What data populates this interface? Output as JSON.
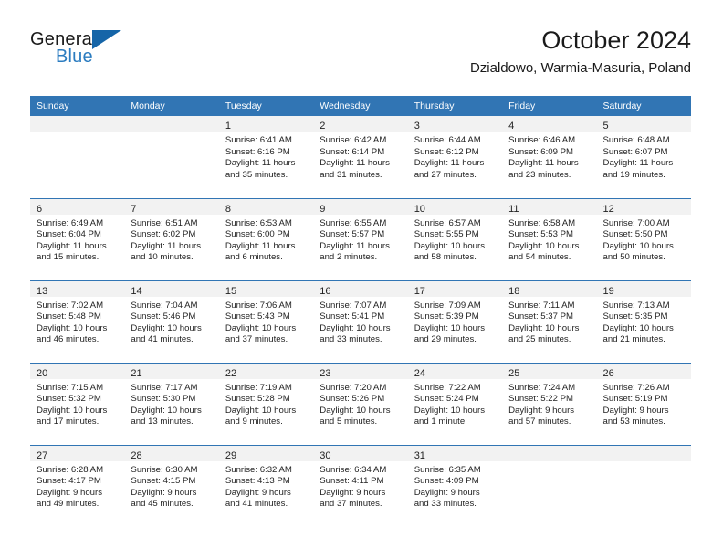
{
  "brand": {
    "line1": "General",
    "line2": "Blue",
    "triangle_icon": "triangle-icon",
    "accent_color": "#2b7cc0"
  },
  "header": {
    "title": "October 2024",
    "subtitle": "Dzialdowo, Warmia-Masuria, Poland"
  },
  "colors": {
    "header_blue": "#3175b4",
    "band_gray": "#f2f2f2",
    "text": "#222222"
  },
  "weekdays": [
    "Sunday",
    "Monday",
    "Tuesday",
    "Wednesday",
    "Thursday",
    "Friday",
    "Saturday"
  ],
  "weeks": [
    [
      {
        "day": "",
        "lines": []
      },
      {
        "day": "",
        "lines": []
      },
      {
        "day": "1",
        "lines": [
          "Sunrise: 6:41 AM",
          "Sunset: 6:16 PM",
          "Daylight: 11 hours",
          "and 35 minutes."
        ]
      },
      {
        "day": "2",
        "lines": [
          "Sunrise: 6:42 AM",
          "Sunset: 6:14 PM",
          "Daylight: 11 hours",
          "and 31 minutes."
        ]
      },
      {
        "day": "3",
        "lines": [
          "Sunrise: 6:44 AM",
          "Sunset: 6:12 PM",
          "Daylight: 11 hours",
          "and 27 minutes."
        ]
      },
      {
        "day": "4",
        "lines": [
          "Sunrise: 6:46 AM",
          "Sunset: 6:09 PM",
          "Daylight: 11 hours",
          "and 23 minutes."
        ]
      },
      {
        "day": "5",
        "lines": [
          "Sunrise: 6:48 AM",
          "Sunset: 6:07 PM",
          "Daylight: 11 hours",
          "and 19 minutes."
        ]
      }
    ],
    [
      {
        "day": "6",
        "lines": [
          "Sunrise: 6:49 AM",
          "Sunset: 6:04 PM",
          "Daylight: 11 hours",
          "and 15 minutes."
        ]
      },
      {
        "day": "7",
        "lines": [
          "Sunrise: 6:51 AM",
          "Sunset: 6:02 PM",
          "Daylight: 11 hours",
          "and 10 minutes."
        ]
      },
      {
        "day": "8",
        "lines": [
          "Sunrise: 6:53 AM",
          "Sunset: 6:00 PM",
          "Daylight: 11 hours",
          "and 6 minutes."
        ]
      },
      {
        "day": "9",
        "lines": [
          "Sunrise: 6:55 AM",
          "Sunset: 5:57 PM",
          "Daylight: 11 hours",
          "and 2 minutes."
        ]
      },
      {
        "day": "10",
        "lines": [
          "Sunrise: 6:57 AM",
          "Sunset: 5:55 PM",
          "Daylight: 10 hours",
          "and 58 minutes."
        ]
      },
      {
        "day": "11",
        "lines": [
          "Sunrise: 6:58 AM",
          "Sunset: 5:53 PM",
          "Daylight: 10 hours",
          "and 54 minutes."
        ]
      },
      {
        "day": "12",
        "lines": [
          "Sunrise: 7:00 AM",
          "Sunset: 5:50 PM",
          "Daylight: 10 hours",
          "and 50 minutes."
        ]
      }
    ],
    [
      {
        "day": "13",
        "lines": [
          "Sunrise: 7:02 AM",
          "Sunset: 5:48 PM",
          "Daylight: 10 hours",
          "and 46 minutes."
        ]
      },
      {
        "day": "14",
        "lines": [
          "Sunrise: 7:04 AM",
          "Sunset: 5:46 PM",
          "Daylight: 10 hours",
          "and 41 minutes."
        ]
      },
      {
        "day": "15",
        "lines": [
          "Sunrise: 7:06 AM",
          "Sunset: 5:43 PM",
          "Daylight: 10 hours",
          "and 37 minutes."
        ]
      },
      {
        "day": "16",
        "lines": [
          "Sunrise: 7:07 AM",
          "Sunset: 5:41 PM",
          "Daylight: 10 hours",
          "and 33 minutes."
        ]
      },
      {
        "day": "17",
        "lines": [
          "Sunrise: 7:09 AM",
          "Sunset: 5:39 PM",
          "Daylight: 10 hours",
          "and 29 minutes."
        ]
      },
      {
        "day": "18",
        "lines": [
          "Sunrise: 7:11 AM",
          "Sunset: 5:37 PM",
          "Daylight: 10 hours",
          "and 25 minutes."
        ]
      },
      {
        "day": "19",
        "lines": [
          "Sunrise: 7:13 AM",
          "Sunset: 5:35 PM",
          "Daylight: 10 hours",
          "and 21 minutes."
        ]
      }
    ],
    [
      {
        "day": "20",
        "lines": [
          "Sunrise: 7:15 AM",
          "Sunset: 5:32 PM",
          "Daylight: 10 hours",
          "and 17 minutes."
        ]
      },
      {
        "day": "21",
        "lines": [
          "Sunrise: 7:17 AM",
          "Sunset: 5:30 PM",
          "Daylight: 10 hours",
          "and 13 minutes."
        ]
      },
      {
        "day": "22",
        "lines": [
          "Sunrise: 7:19 AM",
          "Sunset: 5:28 PM",
          "Daylight: 10 hours",
          "and 9 minutes."
        ]
      },
      {
        "day": "23",
        "lines": [
          "Sunrise: 7:20 AM",
          "Sunset: 5:26 PM",
          "Daylight: 10 hours",
          "and 5 minutes."
        ]
      },
      {
        "day": "24",
        "lines": [
          "Sunrise: 7:22 AM",
          "Sunset: 5:24 PM",
          "Daylight: 10 hours",
          "and 1 minute."
        ]
      },
      {
        "day": "25",
        "lines": [
          "Sunrise: 7:24 AM",
          "Sunset: 5:22 PM",
          "Daylight: 9 hours",
          "and 57 minutes."
        ]
      },
      {
        "day": "26",
        "lines": [
          "Sunrise: 7:26 AM",
          "Sunset: 5:19 PM",
          "Daylight: 9 hours",
          "and 53 minutes."
        ]
      }
    ],
    [
      {
        "day": "27",
        "lines": [
          "Sunrise: 6:28 AM",
          "Sunset: 4:17 PM",
          "Daylight: 9 hours",
          "and 49 minutes."
        ]
      },
      {
        "day": "28",
        "lines": [
          "Sunrise: 6:30 AM",
          "Sunset: 4:15 PM",
          "Daylight: 9 hours",
          "and 45 minutes."
        ]
      },
      {
        "day": "29",
        "lines": [
          "Sunrise: 6:32 AM",
          "Sunset: 4:13 PM",
          "Daylight: 9 hours",
          "and 41 minutes."
        ]
      },
      {
        "day": "30",
        "lines": [
          "Sunrise: 6:34 AM",
          "Sunset: 4:11 PM",
          "Daylight: 9 hours",
          "and 37 minutes."
        ]
      },
      {
        "day": "31",
        "lines": [
          "Sunrise: 6:35 AM",
          "Sunset: 4:09 PM",
          "Daylight: 9 hours",
          "and 33 minutes."
        ]
      },
      {
        "day": "",
        "lines": []
      },
      {
        "day": "",
        "lines": []
      }
    ]
  ]
}
